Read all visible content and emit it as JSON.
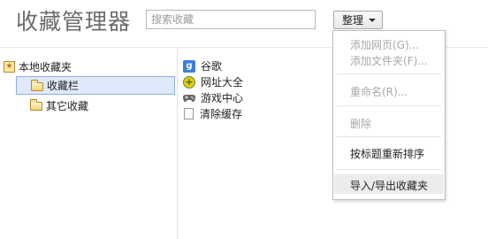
{
  "header": {
    "title": "收藏管理器",
    "search_placeholder": "搜索收藏",
    "organize_label": "整理"
  },
  "tree": {
    "root_label": "本地收藏夹",
    "items": [
      {
        "label": "收藏栏",
        "selected": true
      },
      {
        "label": "其它收藏",
        "selected": false
      }
    ]
  },
  "list": {
    "items": [
      {
        "label": "谷歌",
        "icon": "google-icon"
      },
      {
        "label": "网址大全",
        "icon": "hao123-icon"
      },
      {
        "label": "游戏中心",
        "icon": "gamepad-icon"
      },
      {
        "label": "清除缓存",
        "icon": "page-icon"
      }
    ]
  },
  "menu": {
    "add_page": "添加网页(G)...",
    "add_folder": "添加文件夹(F)...",
    "rename": "重命名(R)...",
    "delete": "删除",
    "sort_by_title": "按标题重新排序",
    "import_export": "导入/导出收藏夹"
  },
  "colors": {
    "selection_bg": "#dfe9f9",
    "selection_border": "#8fb0e3",
    "disabled_text": "#a8a8a8"
  }
}
